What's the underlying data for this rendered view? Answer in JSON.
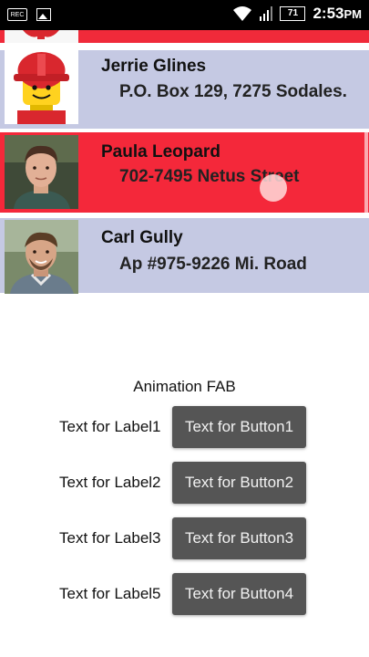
{
  "status_bar": {
    "rec_label": "REC",
    "battery": "71",
    "time": "2:53",
    "time_suffix": "PM",
    "icons": [
      "rec-icon",
      "image-icon",
      "wifi-icon",
      "signal-icon",
      "battery-icon"
    ]
  },
  "list": {
    "colors": {
      "lavender": "#c5c9e3",
      "selected": "#f4283a",
      "partial": "#f02a3a"
    },
    "items": [
      {
        "name": "Jerrie Glines",
        "address": "P.O. Box 129, 7275 Sodales.",
        "selected": false
      },
      {
        "name": "Paula Leopard",
        "address": "702-7495 Netus Street",
        "selected": true
      },
      {
        "name": "Carl Gully",
        "address": "Ap #975-9226 Mi. Road",
        "selected": false
      }
    ]
  },
  "fab": {
    "title": "Animation FAB",
    "rows": [
      {
        "label": "Text for Label1",
        "button": "Text for Button1"
      },
      {
        "label": "Text for Label2",
        "button": "Text for Button2"
      },
      {
        "label": "Text for Label3",
        "button": "Text for Button3"
      },
      {
        "label": "Text for Label5",
        "button": "Text for Button4"
      }
    ]
  }
}
